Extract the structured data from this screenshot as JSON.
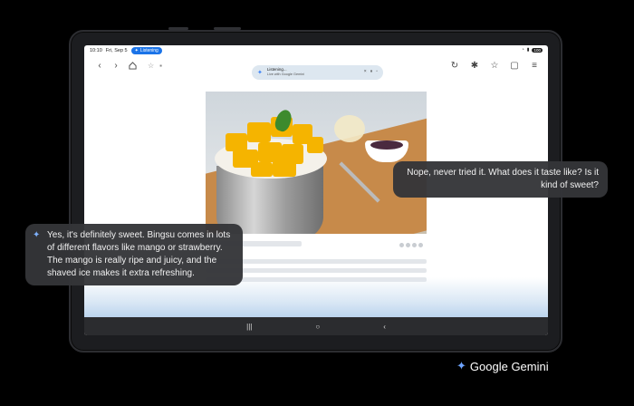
{
  "status_bar": {
    "time": "10:10",
    "date": "Fri, Sep 5",
    "live_pill": "Listening",
    "battery": "100"
  },
  "browser": {
    "icons": [
      "back-icon",
      "forward-icon",
      "home-icon",
      "star-icon",
      "lock-icon",
      "reload-icon",
      "extensions-icon",
      "bookmark-icon",
      "tabs-icon",
      "menu-icon"
    ]
  },
  "live_capsule": {
    "title": "Listening...",
    "subtitle": "Live with Google Gemini"
  },
  "navbar": {
    "recents": "|||",
    "home": "○",
    "back": "‹"
  },
  "chat": {
    "user_message": "Nope, never tried it. What does it taste like? Is it kind of sweet?",
    "gemini_message_line1": "Yes, it's definitely sweet. Bingsu comes in lots of different flavors like mango or strawberry.",
    "gemini_message_line2": "The mango is really ripe and juicy, and the shaved ice makes it extra refreshing."
  },
  "brand": {
    "name": "Google Gemini"
  },
  "colors": {
    "accent": "#1a73e8",
    "gemini_blue": "#6ea4ff",
    "bubble_bg": "#343538"
  }
}
